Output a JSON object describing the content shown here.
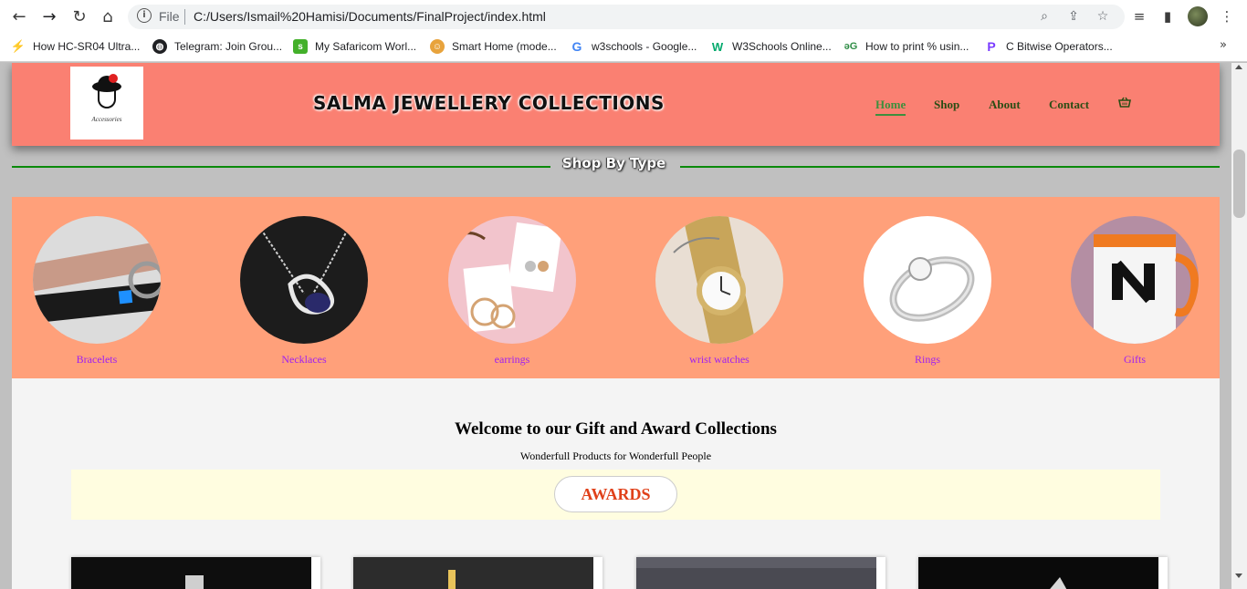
{
  "browser": {
    "omnibox": {
      "scheme_label": "File",
      "url": "C:/Users/Ismail%20Hamisi/Documents/FinalProject/index.html"
    },
    "bookmarks": [
      {
        "label": "How HC-SR04 Ultra...",
        "icon": "lightning-icon",
        "color": "#f4b400"
      },
      {
        "label": "Telegram: Join Grou...",
        "icon": "globe-icon",
        "color": "#202124"
      },
      {
        "label": "My Safaricom Worl...",
        "icon": "safaricom-icon",
        "color": "#43b02a"
      },
      {
        "label": "Smart Home (mode...",
        "icon": "person-icon",
        "color": "#e8a33c"
      },
      {
        "label": "w3schools - Google...",
        "icon": "google-icon",
        "color": "#4285f4"
      },
      {
        "label": "W3Schools Online...",
        "icon": "w3schools-icon",
        "color": "#04aa6d"
      },
      {
        "label": "How to print % usin...",
        "icon": "geeks-icon",
        "color": "#2f8d46"
      },
      {
        "label": "C Bitwise Operators...",
        "icon": "programiz-icon",
        "color": "#7a3cff"
      }
    ]
  },
  "site": {
    "logo_text": "Accessories",
    "title": "SALMA JEWELLERY COLLECTIONS",
    "nav": [
      {
        "label": "Home",
        "active": true
      },
      {
        "label": "Shop",
        "active": false
      },
      {
        "label": "About",
        "active": false
      },
      {
        "label": "Contact",
        "active": false
      }
    ],
    "cart_icon": "basket-icon"
  },
  "shop_by_type": {
    "title": "Shop By Type",
    "items": [
      {
        "label": "Bracelets"
      },
      {
        "label": "Necklaces"
      },
      {
        "label": "earrings"
      },
      {
        "label": "wrist watches"
      },
      {
        "label": "Rings"
      },
      {
        "label": "Gifts"
      }
    ]
  },
  "welcome": {
    "heading": "Welcome to our Gift and Award Collections",
    "subheading": "Wonderfull Products for Wonderfull People",
    "awards_label": "AWARDS"
  },
  "colors": {
    "header_bg": "#fa8072",
    "types_bg": "#ffa07a",
    "type_label": "#a020f0",
    "nav_text": "#2a4d14",
    "nav_active": "#3d8f3d",
    "awards_text": "#e0411a",
    "section_line": "#0a8a0a"
  }
}
